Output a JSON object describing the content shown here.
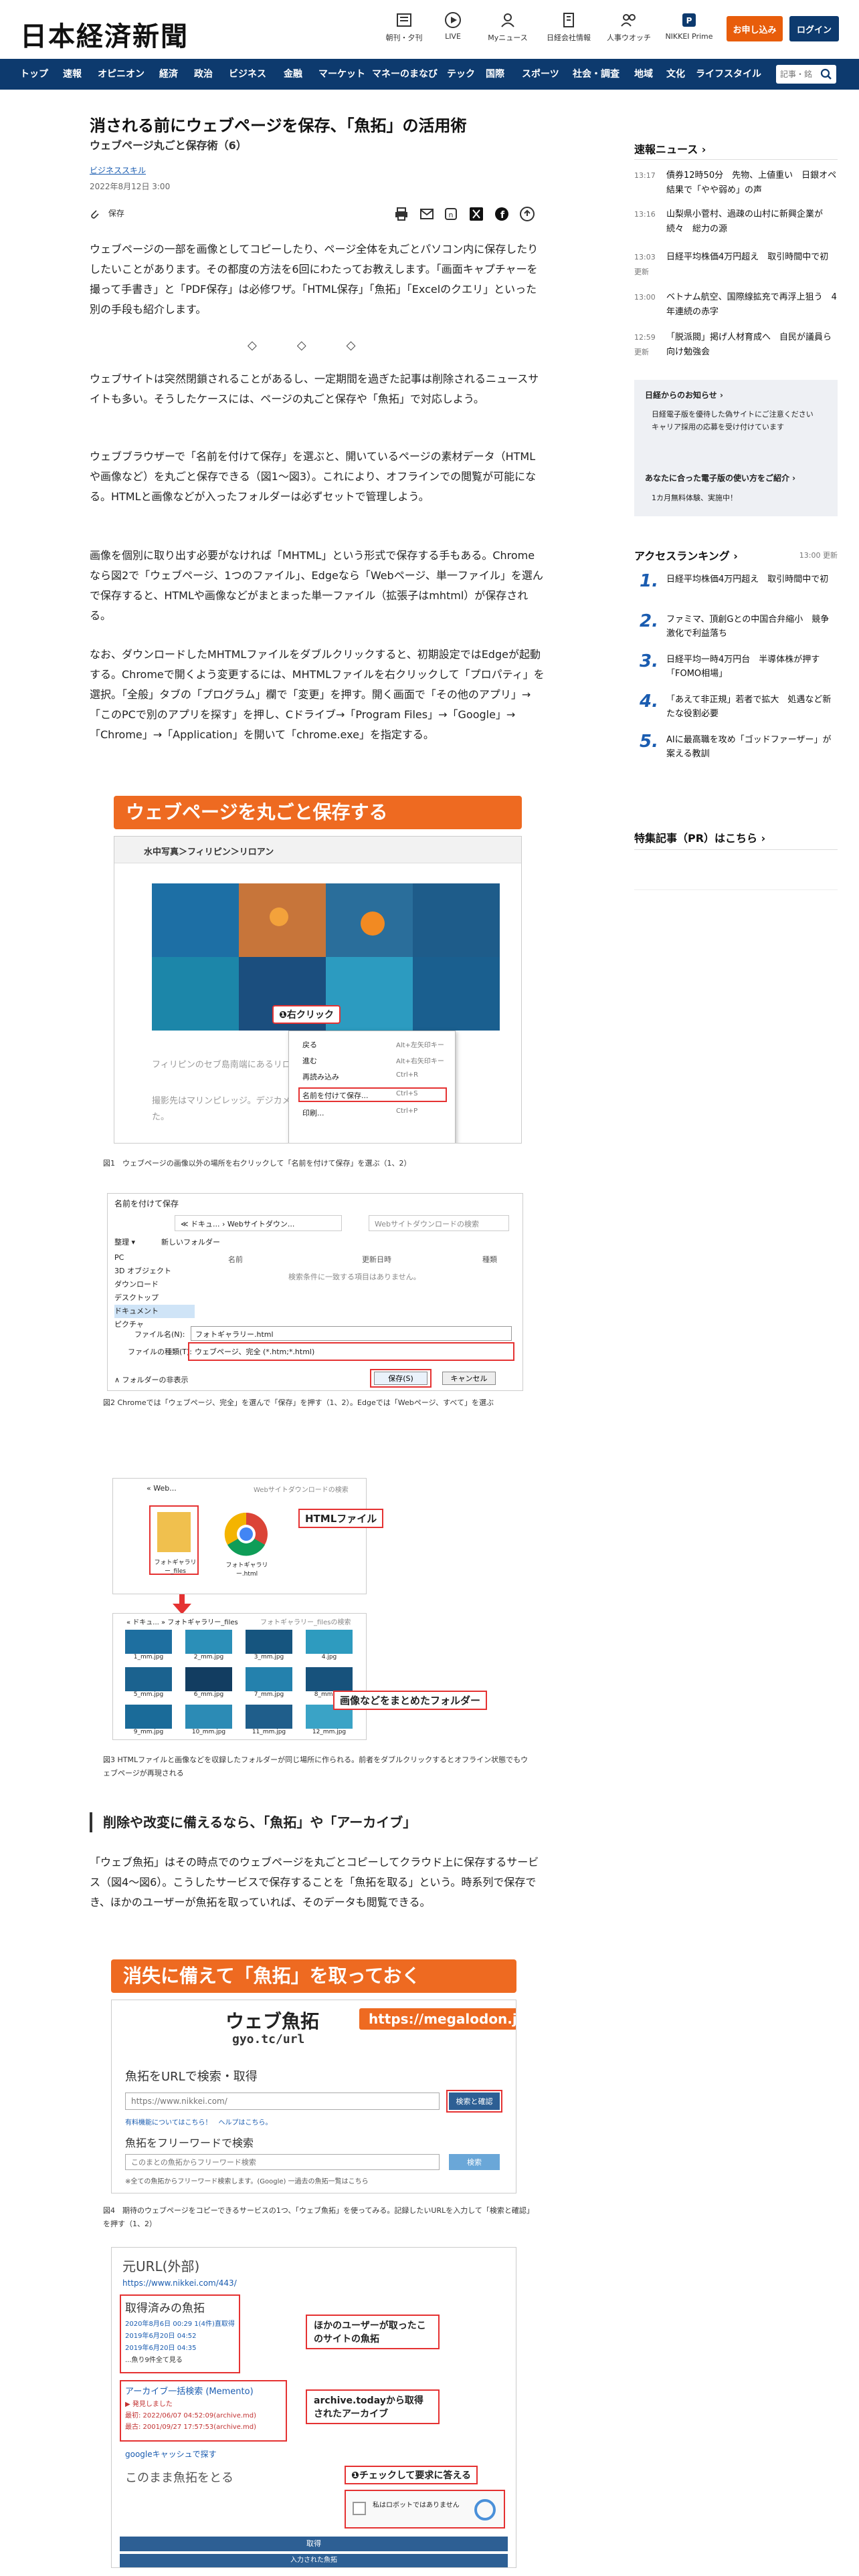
{
  "header": {
    "logo": "日本経済新聞",
    "utils": [
      "朝刊・夕刊",
      "LIVE",
      "Myニュース",
      "日経会社情報",
      "人事ウオッチ",
      "NIKKEI Prime"
    ],
    "subscribe": "お申し込み",
    "login": "ログイン"
  },
  "nav": {
    "items": [
      "トップ",
      "速報",
      "オピニオン",
      "経済",
      "政治",
      "ビジネス",
      "金融",
      "マーケット",
      "マネーのまなび",
      "テック",
      "国際",
      "スポーツ",
      "社会・調査",
      "地域",
      "文化",
      "ライフスタイル"
    ],
    "search_placeholder": "記事・銘"
  },
  "article": {
    "title": "消される前にウェブページを保存、「魚拓」の活用術",
    "subtitle": "ウェブページ丸ごと保存術（6）",
    "tag": "ビジネススキル",
    "date": "2022年8月12日 3:00",
    "save": "保存",
    "paragraphs": [
      "ウェブページの一部を画像としてコピーしたり、ページ全体を丸ごとパソコン内に保存したりしたいことがあります。その都度の方法を6回にわたってお教えします。「画面キャプチャーを撮って手書き」と「PDF保存」は必修ワザ。「HTML保存」「魚拓」「Excelのクエリ」といった別の手段も紹介します。",
      "ウェブサイトは突然閉鎖されることがあるし、一定期間を過ぎた記事は削除されるニュースサイトも多い。そうしたケースには、ページの丸ごと保存や「魚拓」で対応しよう。",
      "ウェブブラウザーで「名前を付けて保存」を選ぶと、開いているページの素材データ（HTMLや画像など）を丸ごと保存できる（図1〜図3）。これにより、オフラインでの閲覧が可能になる。HTMLと画像などが入ったフォルダーは必ずセットで管理しよう。",
      "画像を個別に取り出す必要がなければ「MHTML」という形式で保存する手もある。Chromeなら図2で「ウェブページ、1つのファイル」、Edgeなら「Webページ、単一ファイル」を選んで保存すると、HTMLや画像などがまとまった単一ファイル（拡張子はmhtml）が保存される。",
      "なお、ダウンロードしたMHTMLファイルをダブルクリックすると、初期設定ではEdgeが起動する。Chromeで開くよう変更するには、MHTMLファイルを右クリックして「プロパティ」を選択。「全般」タブの「プログラム」欄で「変更」を押す。開く画面で「その他のアプリ」→「このPCで別のアプリを探す」を押し、Cドライブ→「Program Files」→「Google」→「Chrome」→「Application」を開いて「chrome.exe」を指定する。",
      "「ウェブ魚拓」はその時点でのウェブページを丸ごとコピーしてクラウド上に保存するサービス（図4〜図6）。こうしたサービスで保存することを「魚拓を取る」という。時系列で保存でき、ほかのユーザーが魚拓を取っていれば、そのデータも閲覧できる。"
    ],
    "diamonds": "◇◇◇",
    "h2": "削除や改変に備えるなら、「魚拓」や「アーカイブ」"
  },
  "fig1": {
    "banner": "ウェブページを丸ごと保存する",
    "breadcrumb": "水中写真＞フィリピン＞リロアン",
    "callout": "❶右クリック",
    "text1": "フィリピンのセブ島南端にあるリロアン",
    "text2": "撮影先はマリンピレッジ。デジカメ用の",
    "text3": "た。",
    "menu": [
      {
        "label": "戻る",
        "key": "Alt+左矢印キー"
      },
      {
        "label": "進む",
        "key": "Alt+右矢印キー"
      },
      {
        "label": "再読み込み",
        "key": "Ctrl+R"
      },
      {
        "label": "名前を付けて保存...",
        "key": "Ctrl+S"
      },
      {
        "label": "印刷...",
        "key": "Ctrl+P"
      }
    ],
    "caption": "図1　ウェブページの画像以外の場所を右クリックして「名前を付けて保存」を選ぶ（1、2）"
  },
  "fig2": {
    "title": "名前を付けて保存",
    "path": "≪ ドキュ... › Webサイトダウン...",
    "search": "Webサイトダウンロードの検索",
    "organize": "整理 ▾",
    "newfolder": "新しいフォルダー",
    "cols": [
      "名前",
      "更新日時",
      "種類"
    ],
    "empty": "検索条件に一致する項目はありません。",
    "tree": [
      "PC",
      "3D オブジェクト",
      "ダウンロード",
      "デスクトップ",
      "ドキュメント",
      "ピクチャ"
    ],
    "fname_label": "ファイル名(N):",
    "fname": "フォトギャラリー.html",
    "ftype_label": "ファイルの種類(T):",
    "ftype": "ウェブページ、完全 (*.htm;*.html)",
    "hide": "∧ フォルダーの非表示",
    "save": "保存(S)",
    "cancel": "キャンセル",
    "caption": "図2 Chromeでは「ウェブページ、完全」を選んで「保存」を押す（1、2）。Edgeでは「Webページ、すべて」を選ぶ"
  },
  "fig3": {
    "path1": "« Web...",
    "search1": "Webサイトダウンロードの検索",
    "file1": "フォトギャラリー_files",
    "file2": "フォトギャラリー.html",
    "label1": "HTMLファイル",
    "path2": "« ドキュ... » フォトギャラリー_files",
    "search2": "フォトギャラリー_filesの検索",
    "thumbs": [
      "1_mm.jpg",
      "2_mm.jpg",
      "3_mm.jpg",
      "4.jpg",
      "5_mm.jpg",
      "6_mm.jpg",
      "7_mm.jpg",
      "8_mm.jpg",
      "9_mm.jpg",
      "10_mm.jpg",
      "11_mm.jpg",
      "12_mm.jpg"
    ],
    "label2": "画像などをまとめたフォルダー",
    "caption": "図3 HTMLファイルと画像などを収録したフォルダーが同じ場所に作られる。前者をダブルクリックするとオフライン状態でもウェブページが再現される"
  },
  "fig4": {
    "banner": "消失に備えて「魚拓」を取っておく",
    "logo": "ウェブ魚拓",
    "logo_url": "gyo.tc/url",
    "site": "https://megalodon.jp/",
    "sec1": "魚拓をURLで検索・取得",
    "url_placeholder": "https://www.nikkei.com/",
    "btn1": "検索と確認",
    "note1": "有料機能についてはこちら！　ヘルプはこちら。",
    "sec2": "魚拓をフリーワードで検索",
    "kw_placeholder": "このまとの魚拓からフリーワード検索",
    "btn2": "検索",
    "note2": "※全ての魚拓からフリーワード検索します。(Google) 一過去の魚拓一覧はこちら",
    "caption": "図4　期待のウェブページをコピーできるサービスの1つ、「ウェブ魚拓」を使ってみる。記録したいURLを入力して「検索と確認」を押す（1、2）"
  },
  "fig5": {
    "title": "元URL(外部)",
    "url": "https://www.nikkei.com/443/",
    "sec1": "取得済みの魚拓",
    "dates": [
      "2020年8月6日 00:29 1(4件)直取得",
      "2019年6月20日 04:52",
      "2019年6月20日 04:35",
      "...魚り9件全て見る"
    ],
    "label1": "ほかのユーザーが取ったこのサイトの魚拓",
    "sec2": "アーカイブ一括検索 (Memento)",
    "arch": [
      "▶ 発見しました",
      "最初: 2022/06/07 04:52:09(archive.md)",
      "最古: 2001/09/27 17:57:53(archive.md)"
    ],
    "label2": "archive.todayから取得されたアーカイブ",
    "gcache": "googleキャッシュで探す",
    "sec3": "このまま魚拓をとる",
    "check_label": "❶チェックして要求に答える",
    "captcha": "私はロボットではありません",
    "submit": "取得",
    "submit2": "入力された魚拓"
  },
  "sidebar": {
    "breaking_title": "速報ニュース ›",
    "breaking": [
      {
        "time": "13:17",
        "text": "債券12時50分　先物、上値重い　日銀オペ結果で「やや弱め」の声"
      },
      {
        "time": "13:16",
        "text": "山梨県小菅村、過疎の山村に新興企業が続々　総力の源"
      },
      {
        "time": "13:03\n更新",
        "text": "日経平均株価4万円超え　取引時間中で初"
      },
      {
        "time": "13:00",
        "text": "ベトナム航空、国際線拡充で再浮上狙う　4年連続の赤字"
      },
      {
        "time": "12:59\n更新",
        "text": "「脱派閥」掲げ人材育成へ　自民が議員ら向け勉強会"
      }
    ],
    "box_title": "日経からのお知らせ ›",
    "box_items": [
      "日経電子版を優待した偽サイトにご注意ください",
      "キャリア採用の応募を受け付けています"
    ],
    "box_title2": "あなたに合った電子版の使い方をご紹介 ›",
    "box_items2": [
      "1カ月無料体験、実施中！"
    ],
    "ranking_title": "アクセスランキング ›",
    "ranking_time": "13:00 更新",
    "ranking": [
      {
        "n": "1.",
        "text": "日経平均株価4万円超え　取引時間中で初"
      },
      {
        "n": "2.",
        "text": "ファミマ、頂創Gとの中国合弁縮小　競争激化で利益落ち"
      },
      {
        "n": "3.",
        "text": "日経平均一時4万円台　半導体株が押す「FOMO相場」"
      },
      {
        "n": "4.",
        "text": "「あえて非正規」若者で拡大　処遇など新たな役割必要"
      },
      {
        "n": "5.",
        "text": "AIに最高職を攻め「ゴッドファーザー」が案える教訓"
      }
    ],
    "special": "特集記事（PR）はこちら ›"
  },
  "colors": {
    "navy": "#0d3a6e",
    "orange": "#ee6a21",
    "blue": "#1a5cb0"
  }
}
